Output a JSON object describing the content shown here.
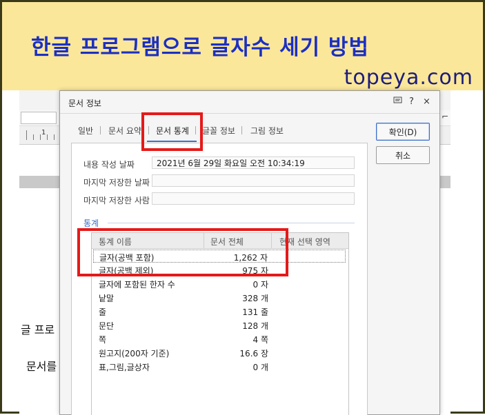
{
  "banner": {
    "title": "한글 프로그램으로 글자수 세기 방법",
    "site": "topeya.com"
  },
  "document": {
    "text_line1": "글 프로",
    "text_line2": "문서를",
    "ruler_mark": "1"
  },
  "dialog": {
    "title": "문서 정보",
    "controls": {
      "help": "?",
      "close": "×"
    },
    "tabs": [
      {
        "label": "일반"
      },
      {
        "label": "문서 요약"
      },
      {
        "label": "문서 통계",
        "active": true
      },
      {
        "label": "글꼴 정보"
      },
      {
        "label": "그림 정보"
      }
    ],
    "buttons": {
      "ok": "확인(D)",
      "cancel": "취소"
    },
    "fields": [
      {
        "label": "내용 작성 날짜",
        "value": "2021년 6월 29일 화요일 오전 10:34:19"
      },
      {
        "label": "마지막 저장한 날짜",
        "value": ""
      },
      {
        "label": "마지막 저장한 사람",
        "value": ""
      }
    ],
    "stats_section": "통계",
    "stats_table": {
      "columns": [
        "통계 이름",
        "문서 전체",
        "현재 선택 영역"
      ],
      "rows": [
        {
          "name": "글자(공백 포함)",
          "value": "1,262 자",
          "selected": true
        },
        {
          "name": "글자(공백 제외)",
          "value": "975 자"
        },
        {
          "name": "글자에 포함된 한자 수",
          "value": "0 자"
        },
        {
          "name": "낱말",
          "value": "328 개"
        },
        {
          "name": "줄",
          "value": "131 줄"
        },
        {
          "name": "문단",
          "value": "128 개"
        },
        {
          "name": "쪽",
          "value": "4 쪽"
        },
        {
          "name": "원고지(200자 기준)",
          "value": "16.6 장"
        },
        {
          "name": "표,그림,글상자",
          "value": "0 개"
        }
      ]
    }
  },
  "colors": {
    "banner_bg": "#fbe79a",
    "banner_title": "#1b2fc2",
    "highlight_box": "#e61919",
    "accent": "#3b6fc9"
  }
}
